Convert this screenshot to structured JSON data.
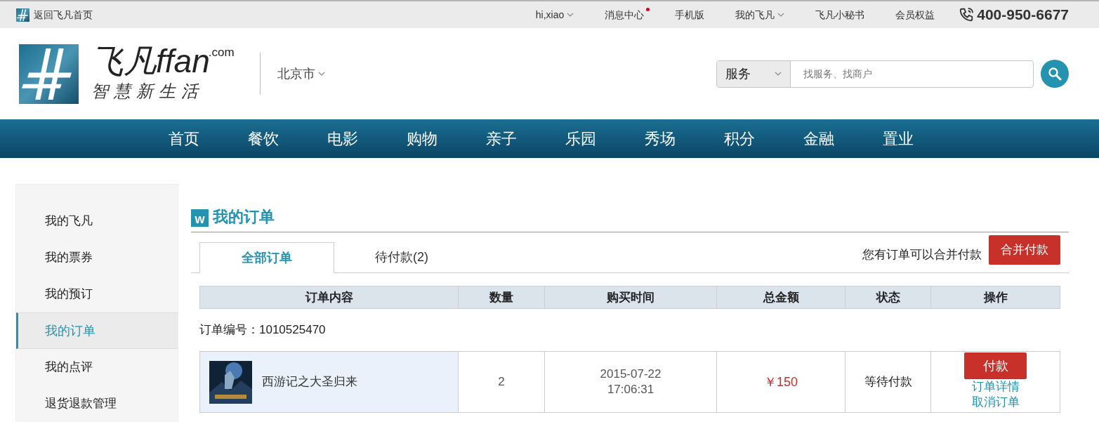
{
  "top_bar": {
    "home_link": "返回飞凡首页",
    "items": [
      {
        "label": "hi,xiao",
        "kind": "dropdown"
      },
      {
        "label": "消息中心",
        "kind": "notice"
      },
      {
        "label": "手机版",
        "kind": "link"
      },
      {
        "label": "我的飞凡",
        "kind": "dropdown"
      },
      {
        "label": "飞凡小秘书",
        "kind": "link"
      },
      {
        "label": "会员权益",
        "kind": "link"
      }
    ],
    "hotline": "400-950-6677"
  },
  "header": {
    "logo": {
      "name": "飞凡ffan",
      "domain": ".com",
      "slogan": "智慧新生活"
    },
    "city": "北京市",
    "search": {
      "category": "服务",
      "placeholder": "找服务、找商户"
    }
  },
  "nav": [
    "首页",
    "餐饮",
    "电影",
    "购物",
    "亲子",
    "乐园",
    "秀场",
    "积分",
    "金融",
    "置业"
  ],
  "sidebar": {
    "items": [
      {
        "label": "我的飞凡",
        "selected": false
      },
      {
        "label": "我的票券",
        "selected": false
      },
      {
        "label": "我的预订",
        "selected": false
      },
      {
        "label": "我的订单",
        "selected": true
      },
      {
        "label": "我的点评",
        "selected": false
      },
      {
        "label": "退货退款管理",
        "selected": false
      }
    ]
  },
  "main": {
    "title_badge": "w",
    "title": "我的订单",
    "tabs": [
      {
        "label": "全部订单",
        "selected": true
      },
      {
        "label": "待付款(2)",
        "selected": false
      }
    ],
    "merge_note": "您有订单可以合并付款",
    "merge_button": "合并付款",
    "table": {
      "columns": [
        "订单内容",
        "数量",
        "购买时间",
        "总金额",
        "状态",
        "操作"
      ],
      "orders": [
        {
          "order_no": "订单编号：1010525470",
          "item": "西游记之大圣归来",
          "quantity": "2",
          "date": "2015-07-22",
          "time": "17:06:31",
          "total": "￥150",
          "status": "等待付款",
          "pay_button": "付款",
          "links": [
            "订单详情",
            "取消订单"
          ]
        }
      ]
    }
  }
}
